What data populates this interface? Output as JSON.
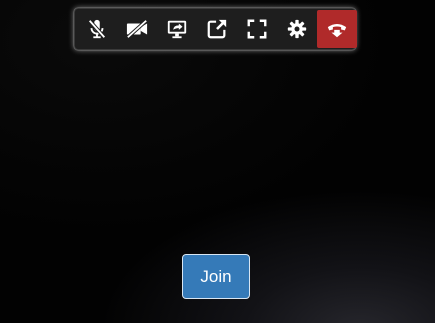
{
  "toolbar": {
    "buttons": [
      {
        "icon": "microphone-muted-icon"
      },
      {
        "icon": "video-off-icon"
      },
      {
        "icon": "screen-share-icon"
      },
      {
        "icon": "external-link-icon"
      },
      {
        "icon": "fullscreen-icon"
      },
      {
        "icon": "gear-icon"
      },
      {
        "icon": "hang-up-icon"
      }
    ],
    "hangup_color": "#b02a2a"
  },
  "join": {
    "label": "Join",
    "color": "#357ab8"
  }
}
